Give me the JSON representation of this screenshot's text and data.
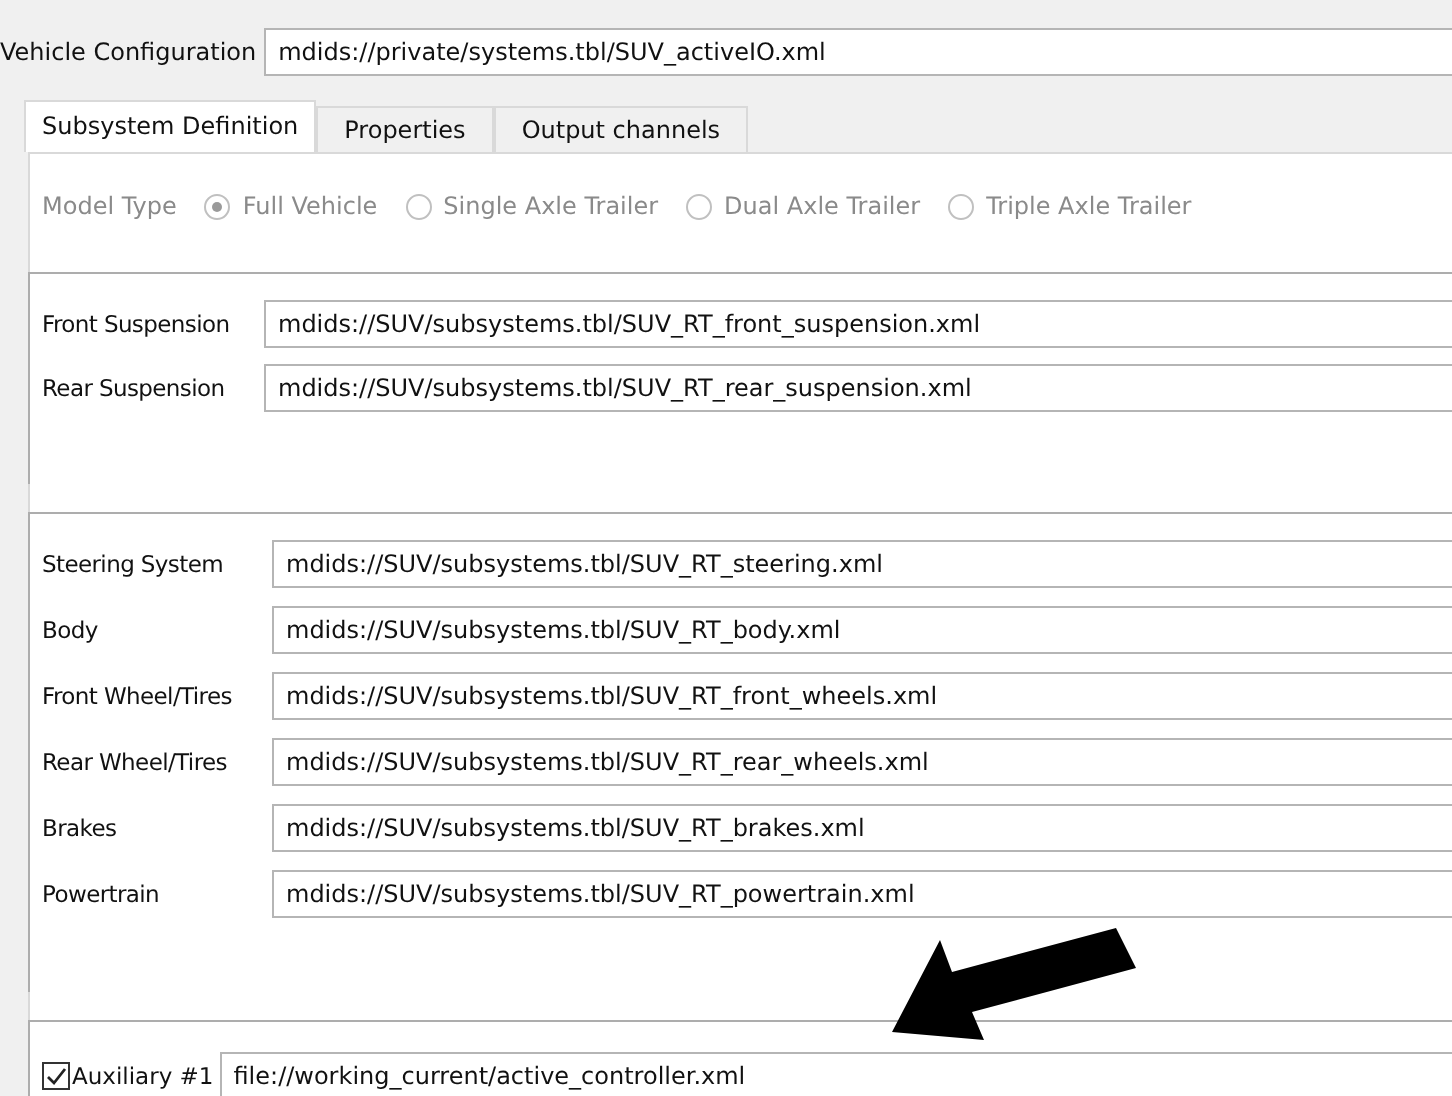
{
  "vehicle_configuration": {
    "label": "Vehicle Configuration",
    "value": "mdids://private/systems.tbl/SUV_activeIO.xml"
  },
  "tabs": [
    {
      "label": "Subsystem Definition",
      "selected": true
    },
    {
      "label": "Properties",
      "selected": false
    },
    {
      "label": "Output channels",
      "selected": false
    }
  ],
  "model_type": {
    "label": "Model Type",
    "disabled": true,
    "options": [
      {
        "label": "Full Vehicle",
        "selected": true
      },
      {
        "label": "Single Axle Trailer",
        "selected": false
      },
      {
        "label": "Dual Axle Trailer",
        "selected": false
      },
      {
        "label": "Triple Axle Trailer",
        "selected": false
      }
    ]
  },
  "suspension_group": [
    {
      "label": "Front Suspension",
      "value": "mdids://SUV/subsystems.tbl/SUV_RT_front_suspension.xml"
    },
    {
      "label": "Rear Suspension",
      "value": "mdids://SUV/subsystems.tbl/SUV_RT_rear_suspension.xml"
    }
  ],
  "subsystem_group": [
    {
      "label": "Steering System",
      "value": "mdids://SUV/subsystems.tbl/SUV_RT_steering.xml"
    },
    {
      "label": "Body",
      "value": "mdids://SUV/subsystems.tbl/SUV_RT_body.xml"
    },
    {
      "label": "Front Wheel/Tires",
      "value": "mdids://SUV/subsystems.tbl/SUV_RT_front_wheels.xml"
    },
    {
      "label": "Rear Wheel/Tires",
      "value": "mdids://SUV/subsystems.tbl/SUV_RT_rear_wheels.xml"
    },
    {
      "label": "Brakes",
      "value": "mdids://SUV/subsystems.tbl/SUV_RT_brakes.xml"
    },
    {
      "label": "Powertrain",
      "value": "mdids://SUV/subsystems.tbl/SUV_RT_powertrain.xml"
    }
  ],
  "auxiliary": [
    {
      "label": "Auxiliary #1",
      "checked": true,
      "value": "file://working_current/active_controller.xml"
    }
  ]
}
